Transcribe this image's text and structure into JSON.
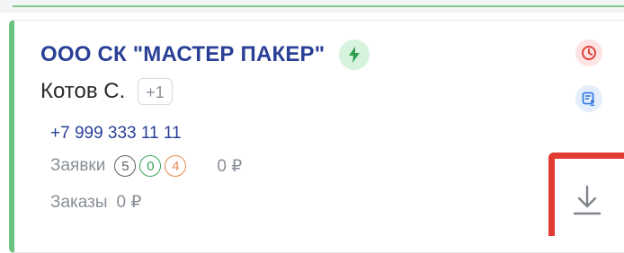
{
  "card": {
    "company_name": "ООО СК \"МАСТЕР ПАКЕР\"",
    "contact_name": "Котов С.",
    "extra_contacts": "+1",
    "phone": "+7 999 333 11 11",
    "requests": {
      "label": "Заявки",
      "counts": [
        {
          "value": "5",
          "color": "#5b5f66"
        },
        {
          "value": "0",
          "color": "#3aa55a"
        },
        {
          "value": "4",
          "color": "#e58a4b"
        }
      ],
      "amount": "0 ₽"
    },
    "orders": {
      "label": "Заказы",
      "amount": "0 ₽"
    },
    "accent_color": "#6cc27c",
    "name_color": "#2a3f96"
  },
  "icons": {
    "status": "lightning-icon",
    "overdue": "clock-icon",
    "document": "document-user-icon",
    "download": "download-icon"
  },
  "highlight_color": "#e23b32"
}
